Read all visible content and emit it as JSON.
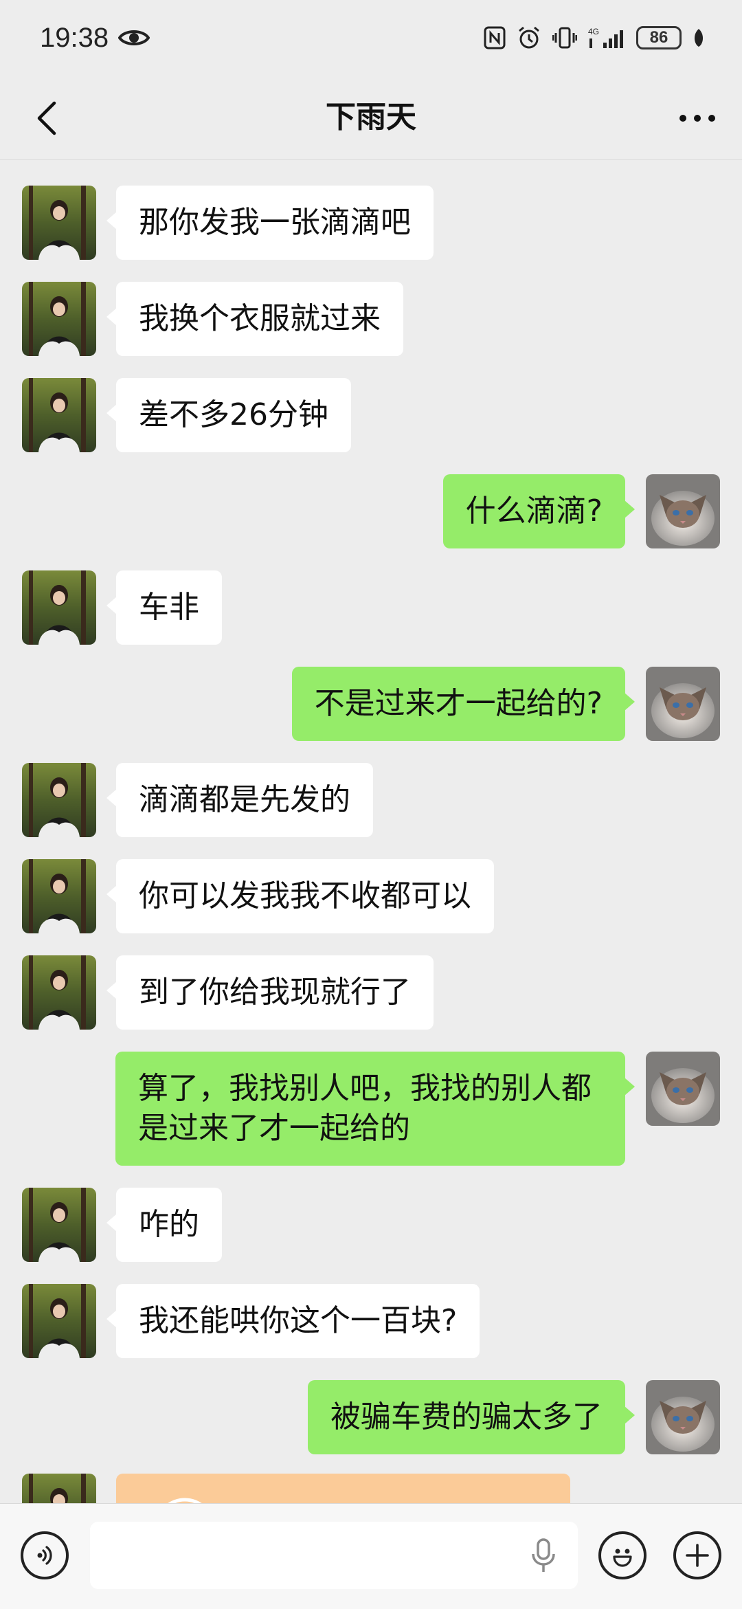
{
  "status_bar": {
    "time": "19:38",
    "icons": [
      "eye-icon",
      "nfc-icon",
      "alarm-icon",
      "vibrate-icon",
      "4g-signal-icon"
    ],
    "battery": "86"
  },
  "header": {
    "title": "下雨天",
    "back_icon": "chevron-left-icon",
    "more_icon": "more-dots-icon"
  },
  "messages": [
    {
      "side": "left",
      "text": "那你发我一张滴滴吧"
    },
    {
      "side": "left",
      "text": "我换个衣服就过来"
    },
    {
      "side": "left",
      "text": "差不多26分钟"
    },
    {
      "side": "right",
      "text": "什么滴滴?"
    },
    {
      "side": "left",
      "text": "车非"
    },
    {
      "side": "right",
      "text": "不是过来才一起给的?"
    },
    {
      "side": "left",
      "text": "滴滴都是先发的"
    },
    {
      "side": "left",
      "text": "你可以发我我不收都可以"
    },
    {
      "side": "left",
      "text": "到了你给我现就行了"
    },
    {
      "side": "right",
      "text": "算了，我找别人吧，我找的别人都\n是过来了才一起给的"
    },
    {
      "side": "left",
      "text": "咋的"
    },
    {
      "side": "left",
      "text": "我还能哄你这个一百块?"
    },
    {
      "side": "right",
      "text": "被骗车费的骗太多了"
    }
  ],
  "input_bar": {
    "voice_icon": "voice-toggle-icon",
    "mic_icon": "microphone-icon",
    "emoji_icon": "emoji-icon",
    "plus_icon": "plus-icon"
  },
  "colors": {
    "bg": "#EDEDED",
    "self_bubble": "#95EC69",
    "other_bubble": "#FFFFFF",
    "transfer": "#FBCB98"
  }
}
